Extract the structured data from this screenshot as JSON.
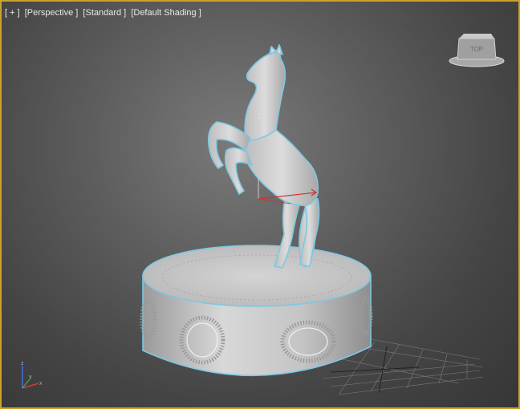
{
  "viewport": {
    "menu_label": "[ + ]",
    "view_label": "[Perspective ]",
    "mode_label": "[Standard ]",
    "shading_label": "[Default Shading ]"
  },
  "viewcube": {
    "face_label": "TOP",
    "icon": "viewcube-icon"
  },
  "gizmo": {
    "axis_z_label": "Z",
    "axis_x_color": "#d03030",
    "axis_z_color": "#c8c8c8"
  },
  "axis_tripod": {
    "x_label": "x",
    "y_label": "y",
    "z_label": "z",
    "x_color": "#d23a3a",
    "y_color": "#3fb54a",
    "z_color": "#4a6fe0"
  },
  "colors": {
    "active_viewport_border": "#c9a227",
    "selection_outline": "#7ec8e3",
    "model_fill": "#d2d2d2"
  }
}
